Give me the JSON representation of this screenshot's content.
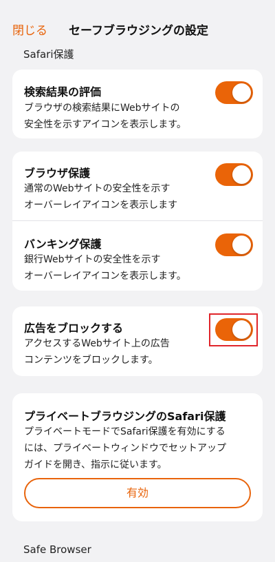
{
  "nav": {
    "close_label": "閉じる",
    "title": "セーフブラウジングの設定"
  },
  "sections": {
    "safari_label": "Safari保護",
    "safe_browser_label": "Safe Browser"
  },
  "search_eval": {
    "title": "検索結果の評価",
    "desc_line1": "ブラウザの検索結果にWebサイトの",
    "desc_line2": "安全性を示すアイコンを表示します。",
    "enabled": true
  },
  "browser_protect": {
    "title": "ブラウザ保護",
    "desc_line1": "通常のWebサイトの安全性を示す",
    "desc_line2": "オーバーレイアイコンを表示します",
    "enabled": true
  },
  "banking_protect": {
    "title": "バンキング保護",
    "desc_line1": "銀行Webサイトの安全性を示す",
    "desc_line2": "オーバーレイアイコンを表示します。",
    "enabled": true
  },
  "ad_block": {
    "title": "広告をブロックする",
    "desc_line1": "アクセスするWebサイト上の広告",
    "desc_line2": "コンテンツをブロックします。",
    "enabled": true
  },
  "private_safari": {
    "title": "プライベートブラウジングのSafari保護",
    "desc_line1": "プライベートモードでSafari保護を有効にする",
    "desc_line2": "には、プライベートウィンドウでセットアップ",
    "desc_line3": "ガイドを開き、指示に従います。",
    "button_label": "有効"
  },
  "colors": {
    "accent": "#e8630a",
    "toggle_on": "#ea6408",
    "highlight": "#e0242a",
    "background": "#f2f2f4"
  }
}
